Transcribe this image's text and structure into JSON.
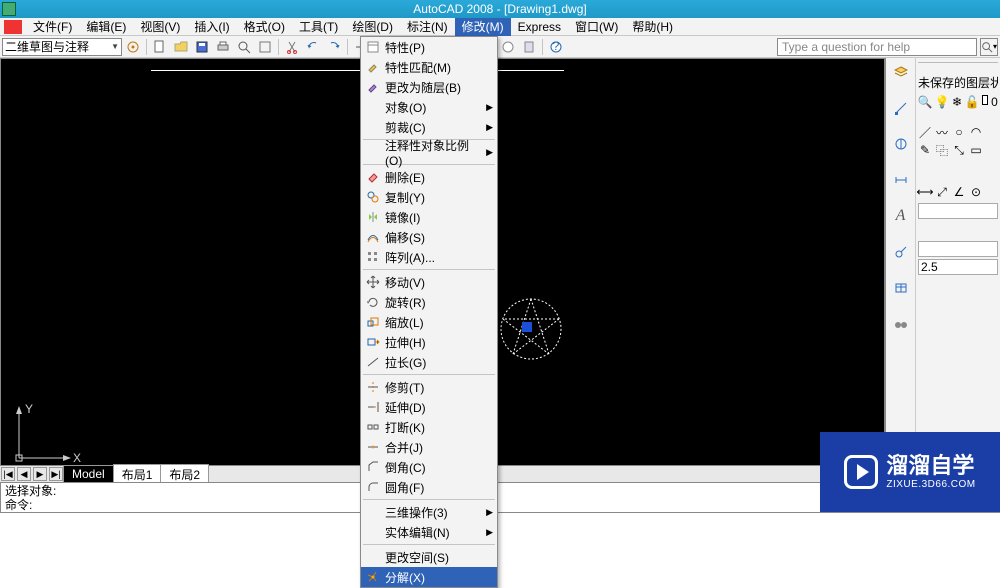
{
  "title": "AutoCAD 2008 - [Drawing1.dwg]",
  "menubar": [
    "文件(F)",
    "编辑(E)",
    "视图(V)",
    "插入(I)",
    "格式(O)",
    "工具(T)",
    "绘图(D)",
    "标注(N)",
    "修改(M)",
    "Express",
    "窗口(W)",
    "帮助(H)"
  ],
  "active_menu_index": 8,
  "workspace_combo": "二维草图与注释",
  "help_placeholder": "Type a question for help",
  "right_panel": {
    "layer_state": "未保存的图层状态",
    "layer_current": "0",
    "dim_value": "2.5"
  },
  "tabs": {
    "nav": [
      "|◀",
      "◀",
      "▶",
      "▶|"
    ],
    "items": [
      "Model",
      "布局1",
      "布局2"
    ],
    "active": 0
  },
  "command_lines": [
    "选择对象:",
    "命令:"
  ],
  "dropdown": {
    "groups": [
      [
        {
          "ic": "props",
          "label": "特性(P)",
          "sub": false
        },
        {
          "ic": "match",
          "label": "特性匹配(M)",
          "sub": false
        },
        {
          "ic": "bylayer",
          "label": "更改为随层(B)",
          "sub": false
        },
        {
          "ic": "",
          "label": "对象(O)",
          "sub": true
        },
        {
          "ic": "",
          "label": "剪裁(C)",
          "sub": true
        }
      ],
      [
        {
          "ic": "",
          "label": "注释性对象比例(O)",
          "sub": true
        }
      ],
      [
        {
          "ic": "erase",
          "label": "删除(E)",
          "sub": false
        },
        {
          "ic": "copy",
          "label": "复制(Y)",
          "sub": false
        },
        {
          "ic": "mirror",
          "label": "镜像(I)",
          "sub": false
        },
        {
          "ic": "offset",
          "label": "偏移(S)",
          "sub": false
        },
        {
          "ic": "array",
          "label": "阵列(A)...",
          "sub": false
        }
      ],
      [
        {
          "ic": "move",
          "label": "移动(V)",
          "sub": false
        },
        {
          "ic": "rotate",
          "label": "旋转(R)",
          "sub": false
        },
        {
          "ic": "scale",
          "label": "缩放(L)",
          "sub": false
        },
        {
          "ic": "stretch",
          "label": "拉伸(H)",
          "sub": false
        },
        {
          "ic": "lengthen",
          "label": "拉长(G)",
          "sub": false
        }
      ],
      [
        {
          "ic": "trim",
          "label": "修剪(T)",
          "sub": false
        },
        {
          "ic": "extend",
          "label": "延伸(D)",
          "sub": false
        },
        {
          "ic": "break",
          "label": "打断(K)",
          "sub": false
        },
        {
          "ic": "join",
          "label": "合并(J)",
          "sub": false
        },
        {
          "ic": "chamfer",
          "label": "倒角(C)",
          "sub": false
        },
        {
          "ic": "fillet",
          "label": "圆角(F)",
          "sub": false
        }
      ],
      [
        {
          "ic": "",
          "label": "三维操作(3)",
          "sub": true
        },
        {
          "ic": "",
          "label": "实体编辑(N)",
          "sub": true
        }
      ],
      [
        {
          "ic": "",
          "label": "更改空间(S)",
          "sub": false
        },
        {
          "ic": "explode",
          "label": "分解(X)",
          "sub": false,
          "hl": true
        }
      ]
    ]
  },
  "watermark": {
    "big": "溜溜自学",
    "small": "ZIXUE.3D66.COM"
  },
  "ucs": {
    "x": "X",
    "y": "Y"
  },
  "chart_data": null
}
